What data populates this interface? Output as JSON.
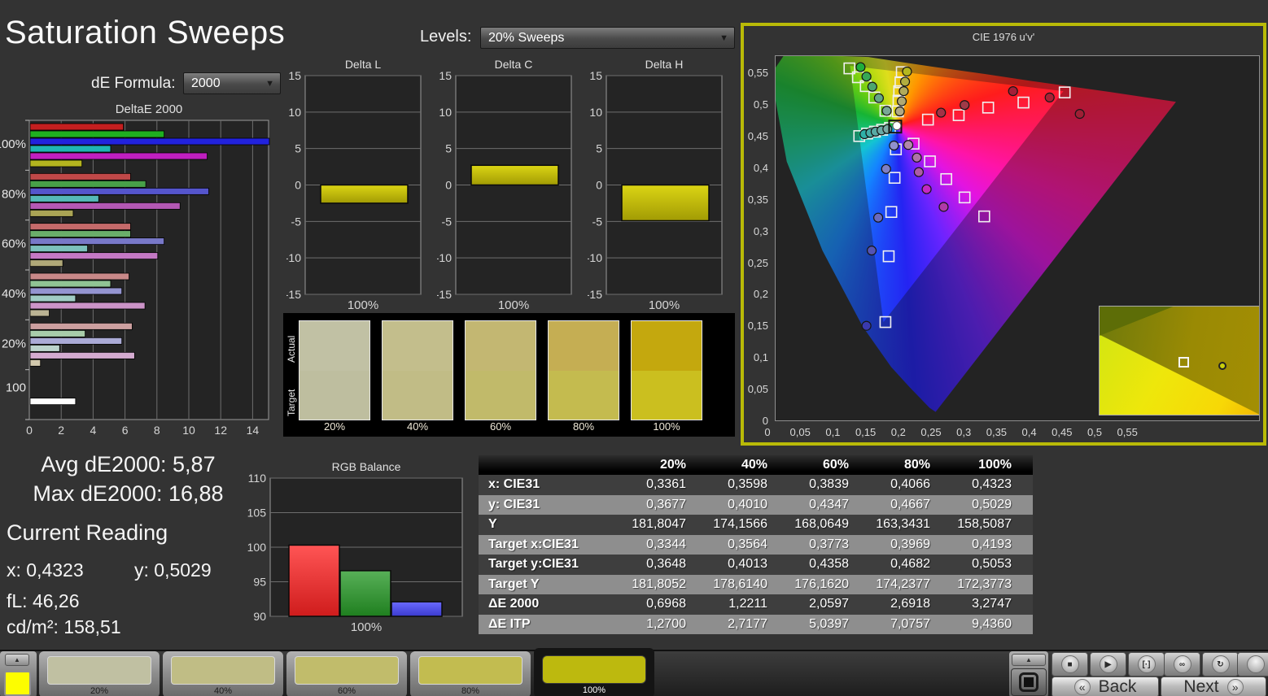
{
  "header": {
    "title": "Saturation Sweeps",
    "de_formula_label": "dE Formula:",
    "de_formula_value": "2000",
    "levels_label": "Levels:",
    "levels_value": "20% Sweeps"
  },
  "stats": {
    "avg": "Avg dE2000: 5,87",
    "max": "Max dE2000: 16,88",
    "current_reading_label": "Current Reading",
    "x": "x: 0,4323",
    "y": "y: 0,5029",
    "fl": "fL: 46,26",
    "cdm2": "cd/m²: 158,51"
  },
  "swatch_panel": {
    "actual_label": "Actual",
    "target_label": "Target",
    "items": [
      {
        "label": "20%",
        "actual": "#c1c1a4",
        "target": "#bebe9f"
      },
      {
        "label": "40%",
        "actual": "#c3be8c",
        "target": "#c1bc86"
      },
      {
        "label": "60%",
        "actual": "#c3b772",
        "target": "#c1ba6a"
      },
      {
        "label": "80%",
        "actual": "#c5ae53",
        "target": "#c4bb4f"
      },
      {
        "label": "100%",
        "actual": "#c4a80e",
        "target": "#cbbf1f"
      }
    ]
  },
  "table": {
    "columns": [
      "20%",
      "40%",
      "60%",
      "80%",
      "100%"
    ],
    "rows": [
      {
        "label": "x: CIE31",
        "values": [
          "0,3361",
          "0,3598",
          "0,3839",
          "0,4066",
          "0,4323"
        ]
      },
      {
        "label": "y: CIE31",
        "values": [
          "0,3677",
          "0,4010",
          "0,4347",
          "0,4667",
          "0,5029"
        ]
      },
      {
        "label": "Y",
        "values": [
          "181,8047",
          "174,1566",
          "168,0649",
          "163,3431",
          "158,5087"
        ]
      },
      {
        "label": "Target x:CIE31",
        "values": [
          "0,3344",
          "0,3564",
          "0,3773",
          "0,3969",
          "0,4193"
        ]
      },
      {
        "label": "Target y:CIE31",
        "values": [
          "0,3648",
          "0,4013",
          "0,4358",
          "0,4682",
          "0,5053"
        ]
      },
      {
        "label": "Target Y",
        "values": [
          "181,8052",
          "178,6140",
          "176,1620",
          "174,2377",
          "172,3773"
        ]
      },
      {
        "label": "ΔE 2000",
        "values": [
          "0,6968",
          "1,2211",
          "2,0597",
          "2,6918",
          "3,2747"
        ]
      },
      {
        "label": "ΔE ITP",
        "values": [
          "1,2700",
          "2,7177",
          "5,0397",
          "7,0757",
          "9,4360"
        ]
      }
    ]
  },
  "pattern_bar": {
    "up_icon": "▲",
    "current_color": "#fdfd00",
    "tiles": [
      {
        "label": "20%",
        "color": "#c0c0a2",
        "selected": false
      },
      {
        "label": "40%",
        "color": "#c0bd85",
        "selected": false
      },
      {
        "label": "60%",
        "color": "#c1bc6b",
        "selected": false
      },
      {
        "label": "80%",
        "color": "#c2bc50",
        "selected": false
      },
      {
        "label": "100%",
        "color": "#bdb90e",
        "selected": true
      }
    ]
  },
  "transport": {
    "up_icon": "▲",
    "buttons": [
      {
        "name": "stop",
        "icon": "■"
      },
      {
        "name": "play",
        "icon": "▶"
      },
      {
        "name": "measure",
        "icon": "[·]"
      },
      {
        "name": "loop",
        "icon": "∞"
      },
      {
        "name": "refresh",
        "icon": "↻"
      },
      {
        "name": "extra",
        "icon": ""
      }
    ],
    "back": {
      "icon": "«",
      "label": "Back"
    },
    "next": {
      "icon": "»",
      "label": "Next"
    }
  },
  "chart_data": {
    "deltae2000": {
      "type": "bar",
      "title": "DeltaE 2000",
      "orientation": "horizontal",
      "xlim": [
        0,
        15
      ],
      "xticks": [
        0,
        2,
        4,
        6,
        8,
        10,
        12,
        14
      ],
      "series_order": [
        "red",
        "green",
        "blue",
        "cyan",
        "magenta",
        "yellow"
      ],
      "groups": [
        {
          "label": "100%",
          "values": [
            5.85,
            8.4,
            16.88,
            5.05,
            11.1,
            3.25
          ],
          "colors": [
            "#c41f1f",
            "#1faf1f",
            "#2222dd",
            "#1fb4b4",
            "#c01fc0",
            "#b4b41f"
          ]
        },
        {
          "label": "80%",
          "values": [
            6.3,
            7.25,
            11.2,
            4.3,
            9.4,
            2.7
          ],
          "colors": [
            "#c04848",
            "#48a048",
            "#5555cc",
            "#55b8b8",
            "#b458b4",
            "#aaa455"
          ]
        },
        {
          "label": "60%",
          "values": [
            6.3,
            6.3,
            8.4,
            3.6,
            8.0,
            2.05
          ],
          "colors": [
            "#c46a6a",
            "#6aae6a",
            "#7878c8",
            "#7cc0bc",
            "#c478c4",
            "#b0a878"
          ]
        },
        {
          "label": "40%",
          "values": [
            6.2,
            5.05,
            5.75,
            2.85,
            7.2,
            1.2
          ],
          "colors": [
            "#c88888",
            "#90c494",
            "#9494d0",
            "#a0ccc4",
            "#cc94c8",
            "#bcb494"
          ]
        },
        {
          "label": "20%",
          "values": [
            6.4,
            3.45,
            5.75,
            1.85,
            6.55,
            0.65
          ],
          "colors": [
            "#cc9f9f",
            "#a8ccaa",
            "#ababd6",
            "#bcd4cc",
            "#d4abd0",
            "#d2c9ae"
          ]
        },
        {
          "label": "100",
          "values": [
            2.85
          ],
          "colors": [
            "#ffffff"
          ]
        }
      ]
    },
    "delta_l": {
      "type": "bar",
      "title": "Delta L",
      "ylim": [
        -15,
        15
      ],
      "yticks": [
        -15,
        -10,
        -5,
        0,
        5,
        10,
        15
      ],
      "value": -2.5,
      "xlabel": "100%",
      "color_top": "#dcd514",
      "color_bottom": "#a19b04"
    },
    "delta_c": {
      "type": "bar",
      "title": "Delta C",
      "ylim": [
        -15,
        15
      ],
      "yticks": [
        -15,
        -10,
        -5,
        0,
        5,
        10,
        15
      ],
      "value": 2.7,
      "xlabel": "100%",
      "color_top": "#dcd514",
      "color_bottom": "#a19b04"
    },
    "delta_h": {
      "type": "bar",
      "title": "Delta H",
      "ylim": [
        -15,
        15
      ],
      "yticks": [
        -15,
        -10,
        -5,
        0,
        5,
        10,
        15
      ],
      "value": -4.9,
      "xlabel": "100%",
      "color_top": "#dcd514",
      "color_bottom": "#a19b04"
    },
    "rgb_balance": {
      "type": "bar",
      "title": "RGB Balance",
      "ylim": [
        90,
        110
      ],
      "yticks": [
        90,
        95,
        100,
        105,
        110
      ],
      "categories": [
        "R",
        "G",
        "B"
      ],
      "values": [
        100.3,
        96.6,
        92.1
      ],
      "colors_top": [
        "#ff5555",
        "#58b058",
        "#6a6aff"
      ],
      "colors_bottom": [
        "#cf1c1c",
        "#1f7f1f",
        "#3a3ace"
      ],
      "xlabel": "100%"
    },
    "cie": {
      "type": "scatter",
      "title": "CIE 1976 u'v'",
      "xlim": [
        0,
        0.7413
      ],
      "ylim": [
        0,
        0.5784
      ],
      "xticks": [
        0,
        0.05,
        0.1,
        0.15,
        0.2,
        0.25,
        0.3,
        0.35,
        0.4,
        0.45,
        0.5,
        0.55
      ],
      "xtick_labels": [
        "0",
        "0,05",
        "0,1",
        "0,15",
        "0,2",
        "0,25",
        "0,3",
        "0,35",
        "0,4",
        "0,45",
        "0,5",
        "0,55"
      ],
      "yticks": [
        0,
        0.05,
        0.1,
        0.15,
        0.2,
        0.25,
        0.3,
        0.35,
        0.4,
        0.45,
        0.5,
        0.55
      ],
      "ytick_labels": [
        "0",
        "0,05",
        "0,1",
        "0,15",
        "0,2",
        "0,25",
        "0,3",
        "0,35",
        "0,4",
        "0,45",
        "0,5",
        "0,55"
      ],
      "locus": [
        [
          0.2557,
          0.016
        ],
        [
          0.2461,
          0.0226
        ],
        [
          0.2347,
          0.035
        ],
        [
          0.2161,
          0.0549
        ],
        [
          0.1877,
          0.0871
        ],
        [
          0.1441,
          0.151
        ],
        [
          0.0828,
          0.2708
        ],
        [
          0.0282,
          0.4117
        ],
        [
          0.0112,
          0.508
        ],
        [
          0.0112,
          0.5603
        ],
        [
          0.0231,
          0.5784
        ],
        [
          0.05,
          0.5784
        ],
        [
          0.0792,
          0.5784
        ],
        [
          0.113,
          0.5784
        ],
        [
          0.153,
          0.577
        ],
        [
          0.2026,
          0.569
        ],
        [
          0.262,
          0.56
        ],
        [
          0.332,
          0.55
        ],
        [
          0.403,
          0.539
        ],
        [
          0.52,
          0.522
        ],
        [
          0.623,
          0.506
        ]
      ],
      "gamut_triangle": [
        [
          0.451,
          0.523
        ],
        [
          0.125,
          0.563
        ],
        [
          0.176,
          0.158
        ]
      ],
      "white_point": {
        "u": 0.194,
        "v": 0.467
      },
      "targets": [
        [
          0.124,
          0.559
        ],
        [
          0.137,
          0.545
        ],
        [
          0.149,
          0.531
        ],
        [
          0.162,
          0.513
        ],
        [
          0.179,
          0.492
        ],
        [
          0.204,
          0.553
        ],
        [
          0.202,
          0.537
        ],
        [
          0.2,
          0.523
        ],
        [
          0.199,
          0.508
        ],
        [
          0.198,
          0.491
        ],
        [
          0.244,
          0.478
        ],
        [
          0.291,
          0.485
        ],
        [
          0.336,
          0.497
        ],
        [
          0.39,
          0.505
        ],
        [
          0.453,
          0.521
        ],
        [
          0.139,
          0.452
        ],
        [
          0.151,
          0.456
        ],
        [
          0.163,
          0.459
        ],
        [
          0.174,
          0.462
        ],
        [
          0.186,
          0.465
        ],
        [
          0.195,
          0.431
        ],
        [
          0.193,
          0.386
        ],
        [
          0.188,
          0.332
        ],
        [
          0.184,
          0.262
        ],
        [
          0.179,
          0.158
        ],
        [
          0.222,
          0.44
        ],
        [
          0.247,
          0.412
        ],
        [
          0.272,
          0.384
        ],
        [
          0.3,
          0.355
        ],
        [
          0.33,
          0.325
        ]
      ],
      "measurements": [
        [
          0.141,
          0.561,
          "#1fae3c"
        ],
        [
          0.15,
          0.546,
          "#37a855"
        ],
        [
          0.159,
          0.53,
          "#4da66e"
        ],
        [
          0.169,
          0.512,
          "#63a686"
        ],
        [
          0.181,
          0.492,
          "#79a795"
        ],
        [
          0.212,
          0.554,
          "#b6b81f"
        ],
        [
          0.209,
          0.538,
          "#b2ae3f"
        ],
        [
          0.207,
          0.523,
          "#b1ab5b"
        ],
        [
          0.204,
          0.507,
          "#b0a973"
        ],
        [
          0.201,
          0.491,
          "#b1aa85"
        ],
        [
          0.264,
          0.489,
          "#a33246"
        ],
        [
          0.3,
          0.501,
          "#a03a48"
        ],
        [
          0.374,
          0.523,
          "#a41f38"
        ],
        [
          0.43,
          0.513,
          "#a82135"
        ],
        [
          0.476,
          0.487,
          "#9e1f35"
        ],
        [
          0.147,
          0.455,
          "#2fb0a8"
        ],
        [
          0.156,
          0.457,
          "#45ada6"
        ],
        [
          0.164,
          0.459,
          "#58aaa4"
        ],
        [
          0.173,
          0.461,
          "#69aaa4"
        ],
        [
          0.182,
          0.463,
          "#79aaa5"
        ],
        [
          0.192,
          0.437,
          "#9090cc"
        ],
        [
          0.18,
          0.4,
          "#7f7fc6"
        ],
        [
          0.168,
          0.323,
          "#6a6abe"
        ],
        [
          0.158,
          0.271,
          "#5353b4"
        ],
        [
          0.15,
          0.152,
          "#3a3aae"
        ],
        [
          0.214,
          0.438,
          "#b287ac"
        ],
        [
          0.227,
          0.418,
          "#b072a8"
        ],
        [
          0.23,
          0.395,
          "#ae5ca6"
        ],
        [
          0.242,
          0.368,
          "#c428c4"
        ],
        [
          0.268,
          0.34,
          "#b03aa8"
        ]
      ],
      "inset": {
        "square": {
          "x": 97,
          "y": 62
        },
        "circle": {
          "x": 146,
          "y": 68
        }
      }
    }
  }
}
